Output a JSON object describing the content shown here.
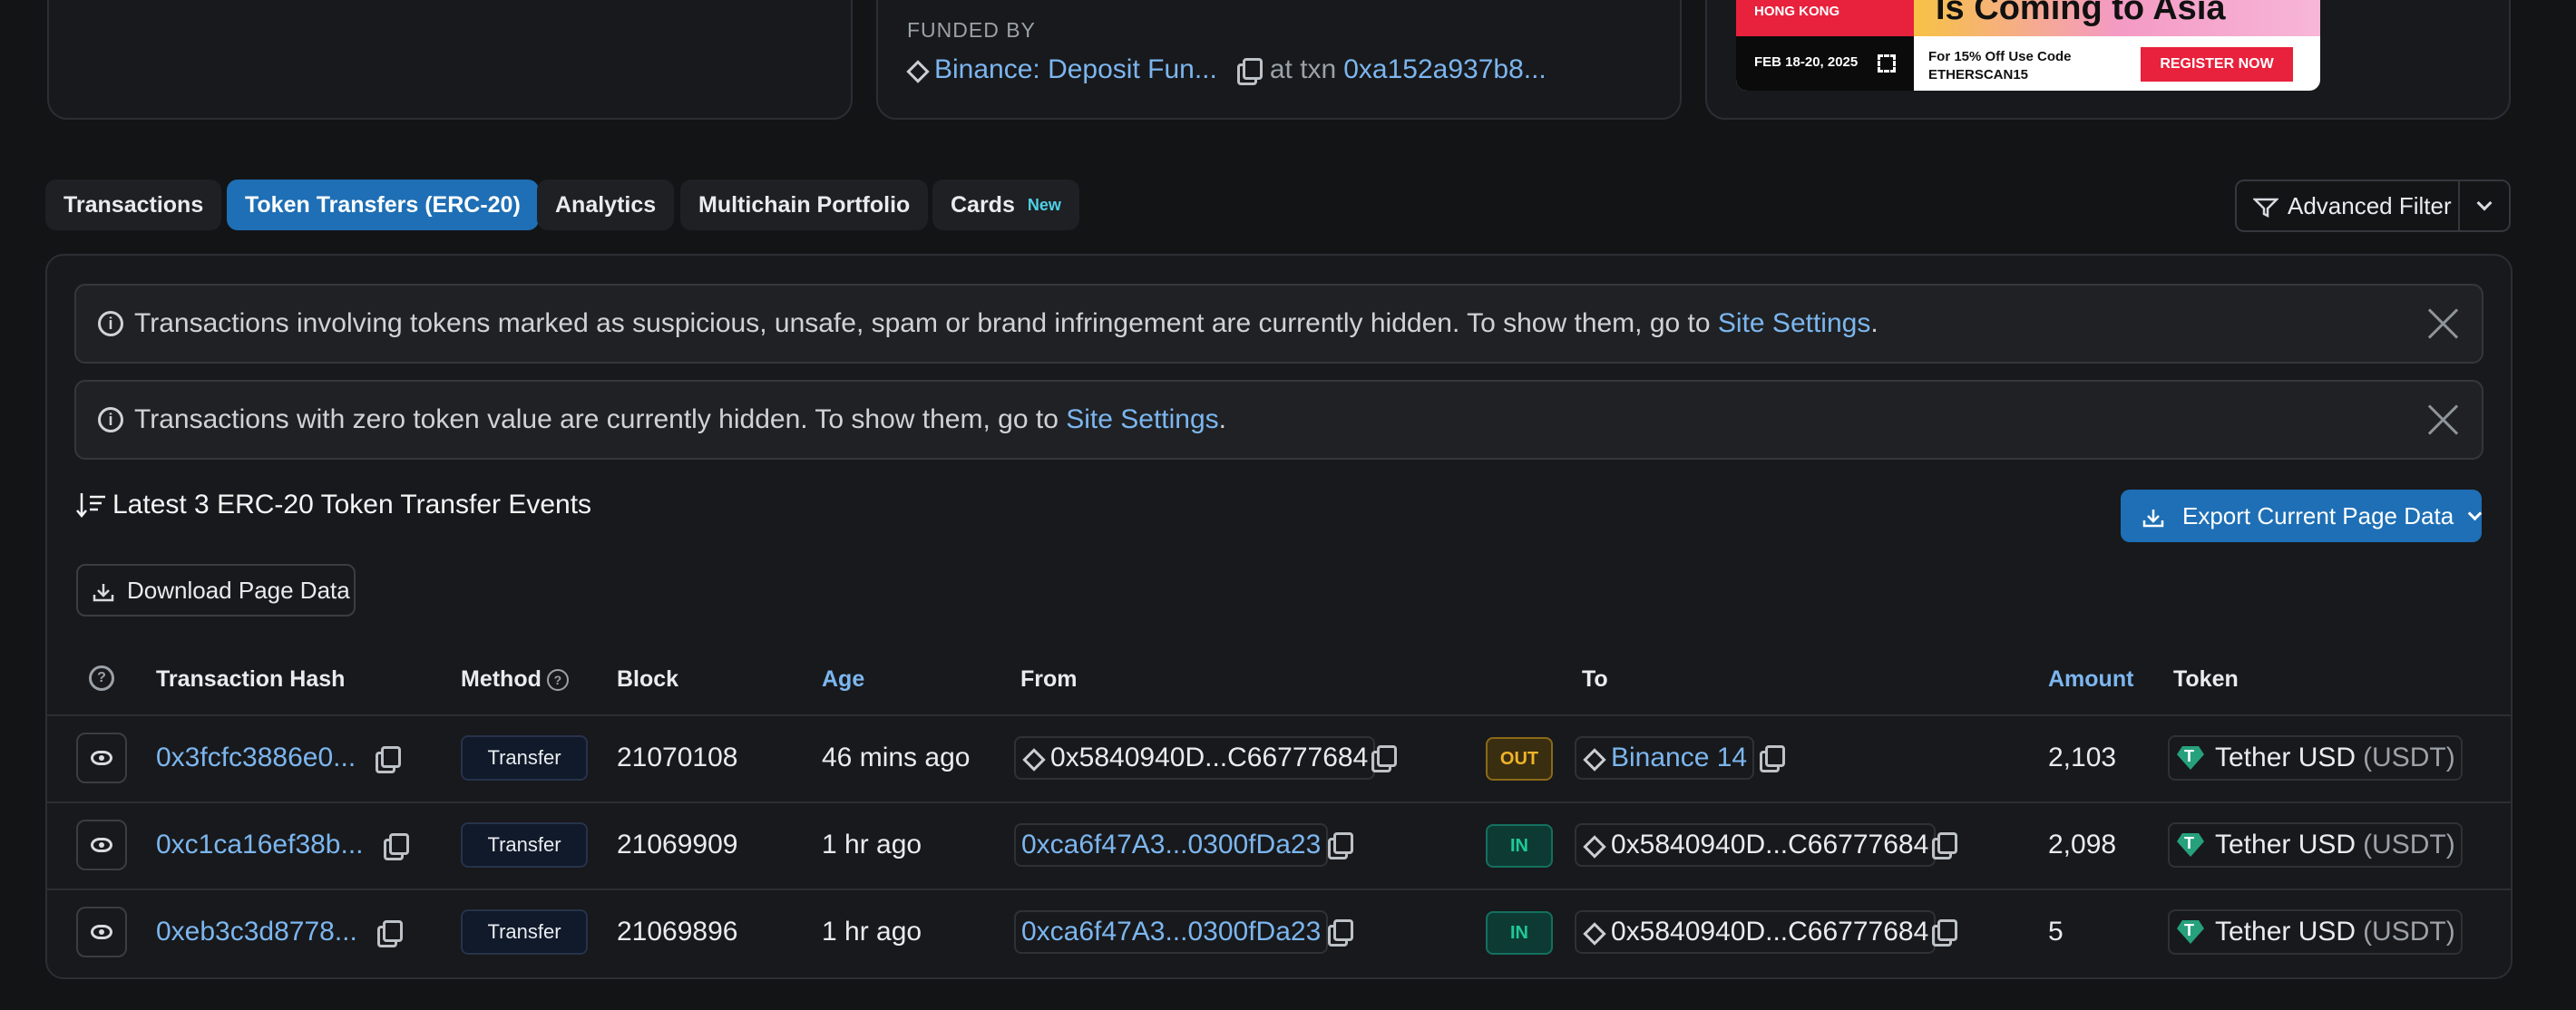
{
  "funded": {
    "label": "FUNDED BY",
    "source": "Binance: Deposit Fun...",
    "at_txn": "at txn",
    "txn": "0xa152a937b8..."
  },
  "ad": {
    "location": "HONG KONG",
    "headline": "Is Coming to Asia",
    "dates": "FEB 18-20, 2025",
    "promo_line1": "For 15% Off Use Code",
    "promo_code": "ETHERSCAN15",
    "cta": "REGISTER NOW"
  },
  "tabs": [
    {
      "label": "Transactions"
    },
    {
      "label": "Token Transfers (ERC-20)"
    },
    {
      "label": "Analytics"
    },
    {
      "label": "Multichain Portfolio"
    },
    {
      "label": "Cards",
      "badge": "New"
    }
  ],
  "advanced_filter": "Advanced Filter",
  "alerts": [
    {
      "text": "Transactions involving tokens marked as suspicious, unsafe, spam or brand infringement are currently hidden. To show them, go to ",
      "link": "Site Settings",
      "end": "."
    },
    {
      "text": "Transactions with zero token value are currently hidden. To show them, go to ",
      "link": "Site Settings",
      "end": "."
    }
  ],
  "summary": "Latest 3 ERC-20 Token Transfer Events",
  "export_button": "Export Current Page Data",
  "download_button": "Download Page Data",
  "columns": {
    "hash": "Transaction Hash",
    "method": "Method",
    "block": "Block",
    "age": "Age",
    "from": "From",
    "to": "To",
    "amount": "Amount",
    "token": "Token"
  },
  "rows": [
    {
      "hash": "0x3fcfc3886e0...",
      "method": "Transfer",
      "block": "21070108",
      "age": "46 mins ago",
      "from": "0x5840940D...C66777684",
      "dir": "OUT",
      "to": "Binance 14",
      "amount": "2,103",
      "token": "Tether USD",
      "symbol": "(USDT)"
    },
    {
      "hash": "0xc1ca16ef38b...",
      "method": "Transfer",
      "block": "21069909",
      "age": "1 hr ago",
      "from": "0xca6f47A3...0300fDa23",
      "dir": "IN",
      "to": "0x5840940D...C66777684",
      "amount": "2,098",
      "token": "Tether USD",
      "symbol": "(USDT)"
    },
    {
      "hash": "0xeb3c3d8778...",
      "method": "Transfer",
      "block": "21069896",
      "age": "1 hr ago",
      "from": "0xca6f47A3...0300fDa23",
      "dir": "IN",
      "to": "0x5840940D...C66777684",
      "amount": "5",
      "token": "Tether USD",
      "symbol": "(USDT)"
    }
  ]
}
